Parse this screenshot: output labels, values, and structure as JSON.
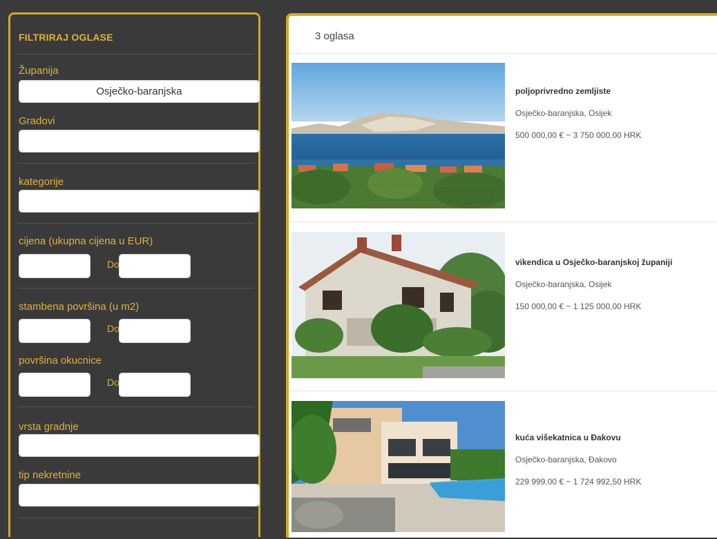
{
  "filter": {
    "title": "FILTRIRAJ OGLASE",
    "zupanija_label": "Županija",
    "zupanija_value": "Osječko-baranjska",
    "gradovi_label": "Gradovi",
    "gradovi_value": "",
    "kategorije_label": "kategorije",
    "kategorije_value": "",
    "cijena_label": "cijena (ukupna cijena u EUR)",
    "do_label": "Do",
    "stambena_label": "stambena površina (u m2)",
    "okucnica_label": "površina okucnice",
    "vrsta_label": "vrsta gradnje",
    "tip_label": "tip nekretnine"
  },
  "results": {
    "count_text": "3 oglasa",
    "listings": [
      {
        "title": "poljoprivredno zemljiste",
        "location": "Osječko-baranjska, Osijek",
        "price": "500 000,00 € ~ 3 750 000,00 HRK",
        "image": "sea-coast-landscape-photo"
      },
      {
        "title": "vikendica u Osječko-baranjskoj županiji",
        "location": "Osječko-baranjska, Osijek",
        "price": "150 000,00 € ~ 1 125 000,00 HRK",
        "image": "white-house-photo"
      },
      {
        "title": "kuća višekatnica u Đakovu",
        "location": "Osječko-baranjska, Đakovo",
        "price": "229 999,00 € ~ 1 724 992,50 HRK",
        "image": "modern-house-pool-photo"
      }
    ]
  },
  "colors": {
    "accent": "#d4a62a",
    "sidebar_bg": "#3a3a3a",
    "label": "#e0b23a"
  }
}
